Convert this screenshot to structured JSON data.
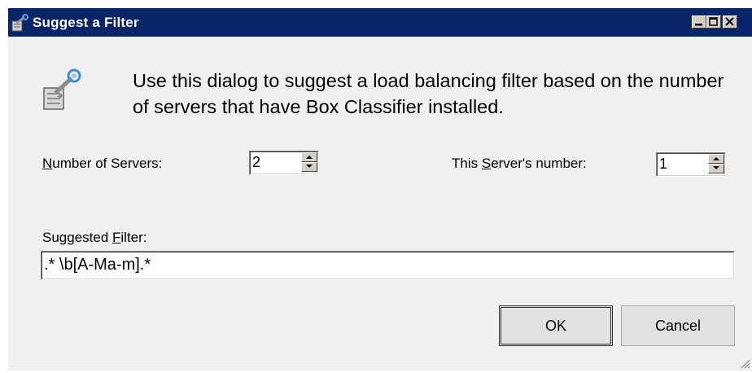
{
  "window": {
    "title": "Suggest a Filter",
    "icon": "filter-key-icon",
    "controls": [
      "minimize-icon",
      "maximize-icon",
      "close-icon"
    ]
  },
  "description": "Use this dialog to suggest a load balancing filter based on the number of servers that have Box Classifier installed.",
  "num_servers": {
    "label_access": "N",
    "label_rest": "umber of Servers:",
    "value": "2"
  },
  "server_number": {
    "label_pre": "This ",
    "label_access": "S",
    "label_post": "erver's number:",
    "value": "1"
  },
  "filter": {
    "label_pre": "Suggested ",
    "label_access": "F",
    "label_post": "ilter:",
    "value": ".* \\b[A-Ma-m].*"
  },
  "buttons": {
    "ok": "OK",
    "cancel": "Cancel"
  },
  "colors": {
    "titlebar": "#0a246a",
    "dialog_bg": "#f0f0f0"
  }
}
